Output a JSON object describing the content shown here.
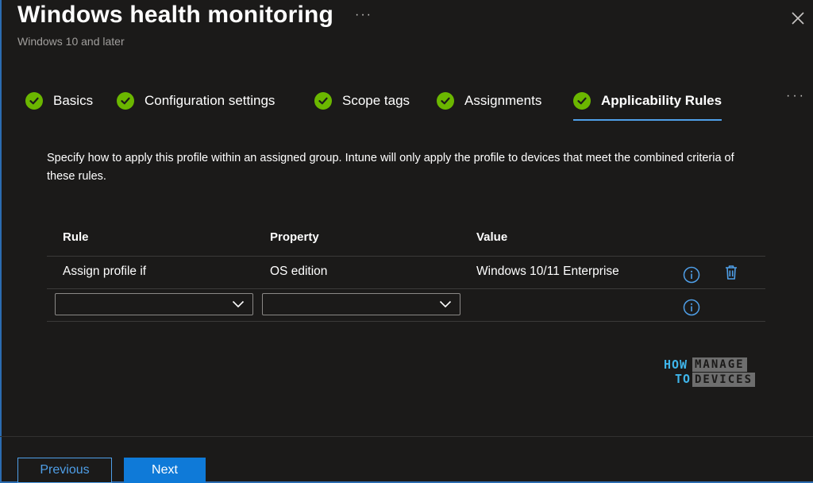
{
  "header": {
    "title": "Windows health monitoring",
    "subtitle": "Windows 10 and later",
    "more_label": "···"
  },
  "tabs": [
    {
      "label": "Basics",
      "status": "complete"
    },
    {
      "label": "Configuration settings",
      "status": "complete"
    },
    {
      "label": "Scope tags",
      "status": "complete"
    },
    {
      "label": "Assignments",
      "status": "complete"
    },
    {
      "label": "Applicability Rules",
      "status": "complete",
      "active": true
    }
  ],
  "tabs_more_label": "···",
  "description": "Specify how to apply this profile within an assigned group. Intune will only apply the profile to devices that meet the combined criteria of these rules.",
  "table": {
    "headers": {
      "rule": "Rule",
      "property": "Property",
      "value": "Value"
    },
    "rows": [
      {
        "rule": "Assign profile if",
        "property": "OS edition",
        "value": "Windows 10/11 Enterprise"
      }
    ],
    "new_row": {
      "rule_value": "",
      "property_value": ""
    }
  },
  "logo": {
    "how": "HOW",
    "to": "TO",
    "manage": "MANAGE",
    "devices": "DEVICES"
  },
  "footer": {
    "previous_label": "Previous",
    "next_label": "Next"
  },
  "colors": {
    "background": "#1b1a19",
    "check_green": "#6bb700",
    "accent_blue": "#4f9fe8",
    "primary_button": "#0f7ad8"
  },
  "icons": {
    "close": "close-icon",
    "check": "checkmark-circle-icon",
    "info": "info-icon",
    "delete": "trash-icon",
    "dropdown": "chevron-down-icon"
  }
}
